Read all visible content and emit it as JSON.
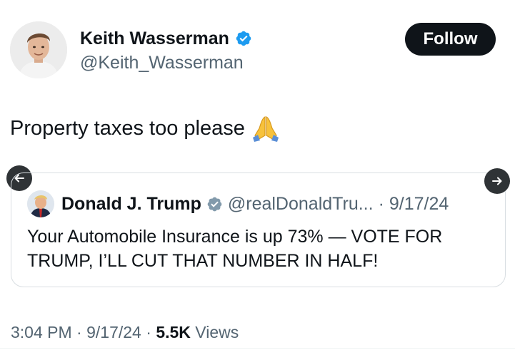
{
  "author": {
    "display_name": "Keith Wasserman",
    "handle": "@Keith_Wasserman",
    "verified_icon": "verified-badge-icon",
    "avatar_icon": "profile-photo"
  },
  "follow_button": {
    "label": "Follow"
  },
  "tweet": {
    "text": "Property taxes too please",
    "emoji_icon": "folded-hands-emoji"
  },
  "quoted_tweet": {
    "display_name": "Donald J. Trump",
    "handle": "@realDonaldTru...",
    "separator": "·",
    "date": "9/17/24",
    "text": "Your Automobile Insurance is up 73% — VOTE FOR TRUMP, I’LL CUT THAT NUMBER IN HALF!"
  },
  "nav": {
    "left_icon": "arrow-left-icon",
    "right_icon": "arrow-right-icon"
  },
  "footer": {
    "time": "3:04 PM",
    "separator": "·",
    "date": "9/17/24",
    "views_count": "5.5K",
    "views_label": "Views"
  },
  "colors": {
    "text_primary": "#0f1419",
    "text_secondary": "#536471",
    "verified_blue": "#1d9bf0",
    "follow_bg": "#0f1419",
    "card_border": "#d9dee2"
  }
}
